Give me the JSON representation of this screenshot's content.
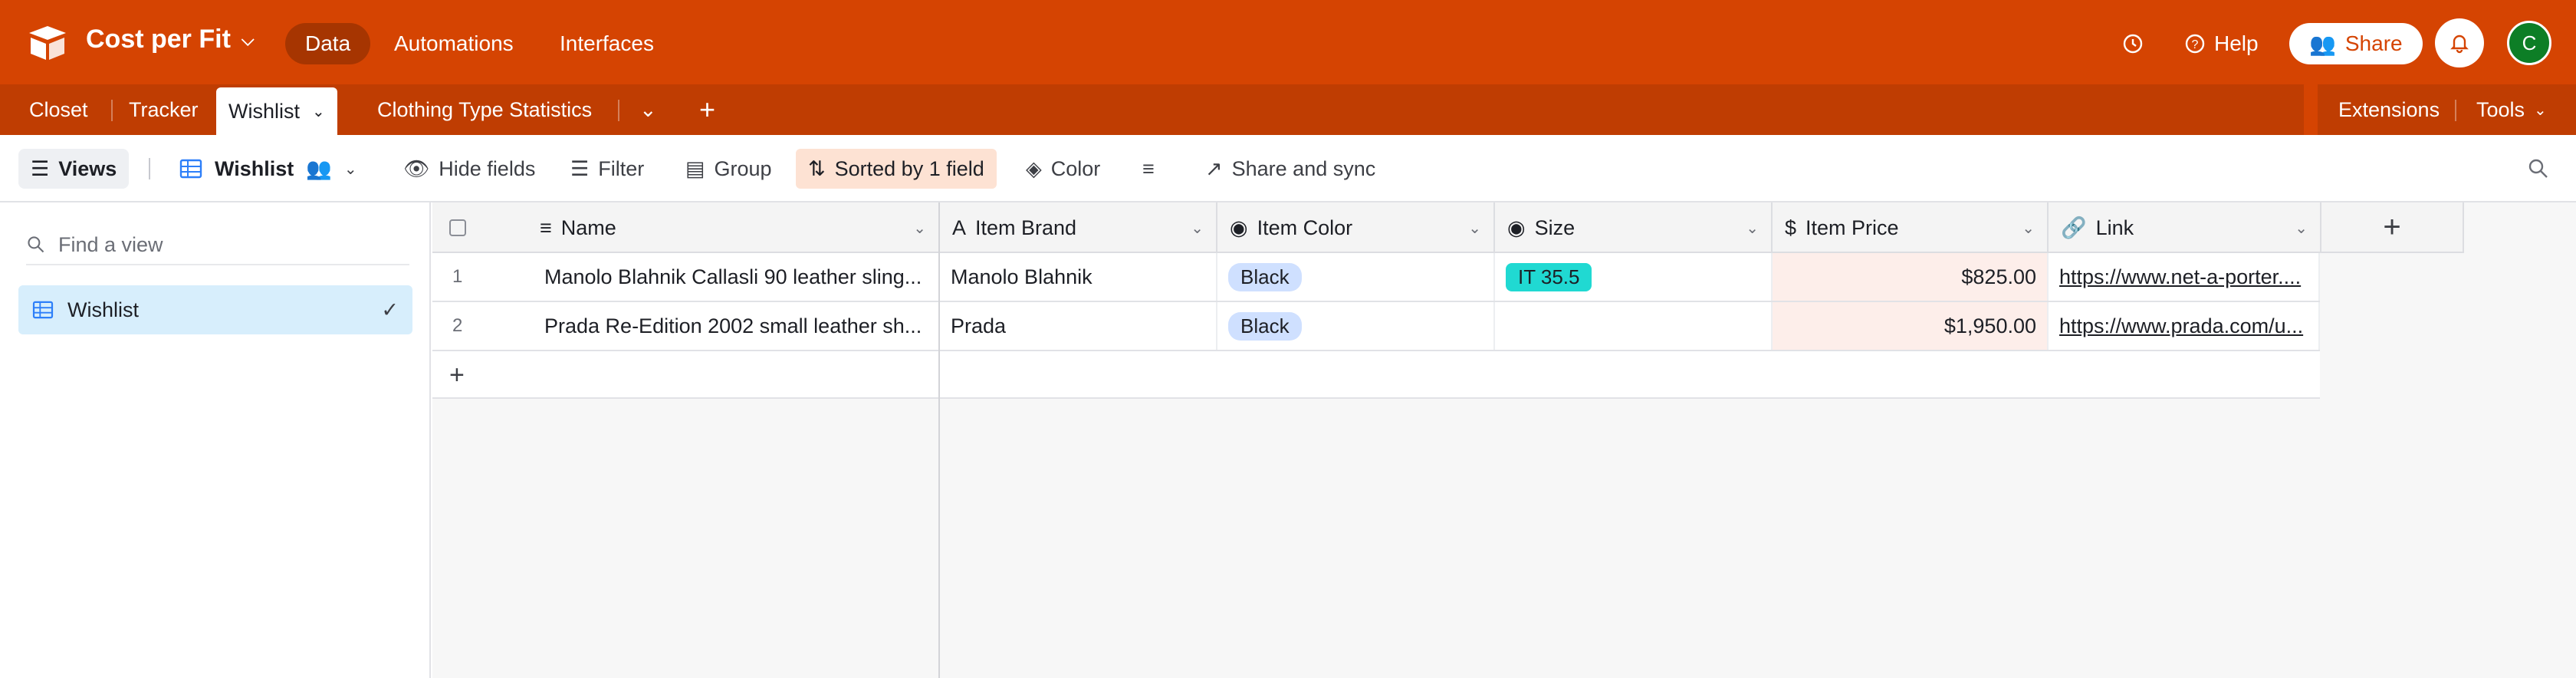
{
  "app": {
    "base_title": "Cost per Fit",
    "nav": [
      "Data",
      "Automations",
      "Interfaces"
    ],
    "help_label": "Help",
    "share_label": "Share",
    "avatar_initial": "C"
  },
  "tabs": {
    "items": [
      "Closet",
      "Tracker",
      "Wishlist",
      "Clothing Type Statistics"
    ],
    "extensions_label": "Extensions",
    "tools_label": "Tools"
  },
  "toolbar": {
    "views_label": "Views",
    "current_view": "Wishlist",
    "hide_fields": "Hide fields",
    "filter": "Filter",
    "group": "Group",
    "sorted": "Sorted by 1 field",
    "color": "Color",
    "share_sync": "Share and sync"
  },
  "sidebar": {
    "find_placeholder": "Find a view",
    "views": [
      "Wishlist"
    ]
  },
  "grid": {
    "columns": [
      "Name",
      "Item Brand",
      "Item Color",
      "Size",
      "Item Price",
      "Link"
    ],
    "rows": [
      {
        "num": "1",
        "name": "Manolo Blahnik Callasli 90 leather sling...",
        "brand": "Manolo Blahnik",
        "color": "Black",
        "size": "IT 35.5",
        "price": "$825.00",
        "link": "https://www.net-a-porter...."
      },
      {
        "num": "2",
        "name": "Prada Re-Edition 2002 small leather sh...",
        "brand": "Prada",
        "color": "Black",
        "size": "",
        "price": "$1,950.00",
        "link": "https://www.prada.com/u..."
      }
    ]
  },
  "colors": {
    "brand": "#d54402",
    "brand_dark": "#bf3d02",
    "size_pill": "#20d9d2",
    "color_pill": "#cfe0ff",
    "price_cell": "#fdeeea"
  }
}
